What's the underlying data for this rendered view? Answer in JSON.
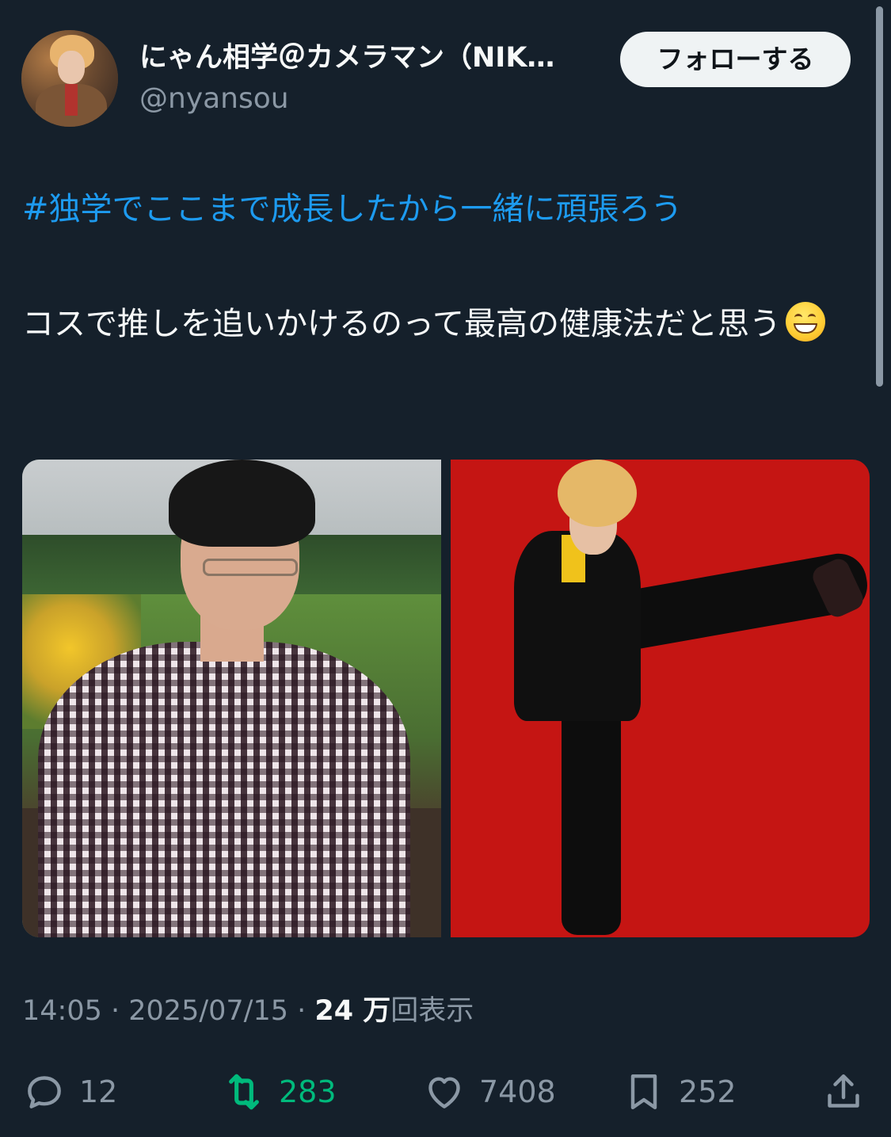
{
  "tweet": {
    "author": {
      "display_name": "にゃん相学＠カメラマン（NIK…",
      "handle": "@nyansou"
    },
    "follow_label": "フォローする",
    "hashtag": "#独学でここまで成長したから一緒に頑張ろう",
    "body": "コスで推しを追いかけるのって最高の健康法だと思う",
    "emoji": "grinning-face-with-smiling-eyes",
    "media": {
      "count": 2
    },
    "meta": {
      "time": "14:05",
      "date": "2025/07/15",
      "views_value": "24 万",
      "views_label": "回表示"
    },
    "actions": {
      "reply_count": "12",
      "retweet_count": "283",
      "like_count": "7408",
      "bookmark_count": "252"
    }
  },
  "colors": {
    "background": "#15202b",
    "link": "#1d9bf0",
    "muted": "#8b98a5",
    "retweet_active": "#00ba7c"
  }
}
